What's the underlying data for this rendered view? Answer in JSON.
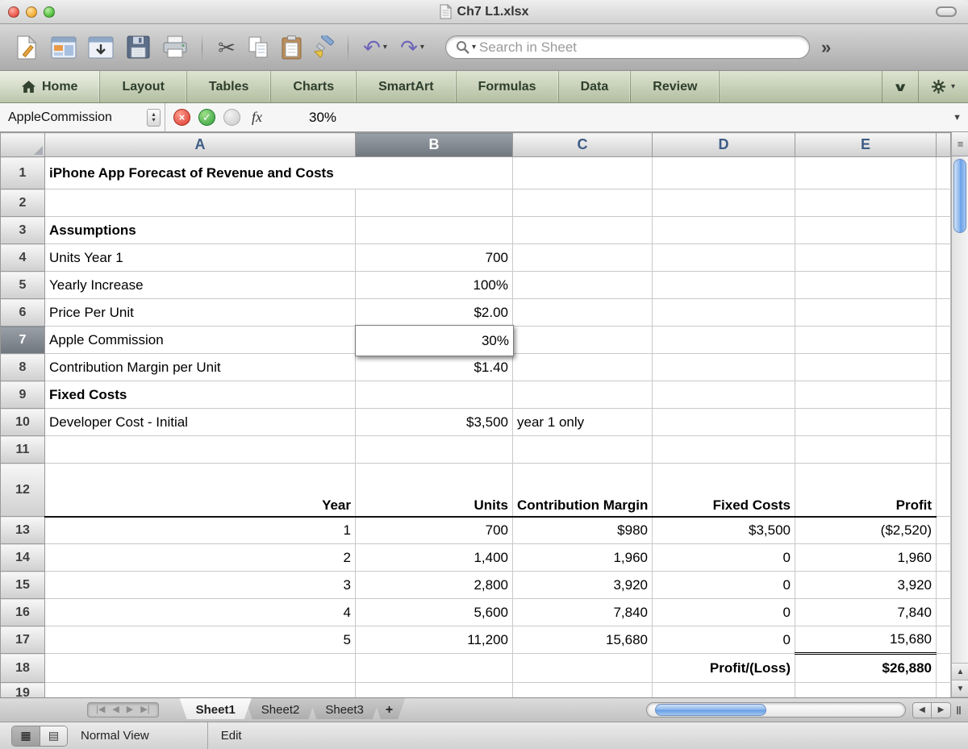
{
  "window": {
    "title": "Ch7 L1.xlsx"
  },
  "toolbar": {
    "search_placeholder": "Search in Sheet",
    "overflow": "»"
  },
  "ribbon": {
    "tabs": [
      "Home",
      "Layout",
      "Tables",
      "Charts",
      "SmartArt",
      "Formulas",
      "Data",
      "Review"
    ]
  },
  "formula_bar": {
    "name_box": "AppleCommission",
    "fx": "fx",
    "value": "30%"
  },
  "grid": {
    "columns": [
      "A",
      "B",
      "C",
      "D",
      "E"
    ],
    "rows": {
      "r1": {
        "n": "1",
        "a": "iPhone App Forecast of Revenue and Costs"
      },
      "r2": {
        "n": "2"
      },
      "r3": {
        "n": "3",
        "a": "Assumptions"
      },
      "r4": {
        "n": "4",
        "a": "Units Year 1",
        "b": "700"
      },
      "r5": {
        "n": "5",
        "a": "Yearly Increase",
        "b": "100%"
      },
      "r6": {
        "n": "6",
        "a": "Price Per Unit",
        "b": "$2.00"
      },
      "r7": {
        "n": "7",
        "a": "Apple Commission",
        "b": "30%"
      },
      "r8": {
        "n": "8",
        "a": "Contribution Margin per Unit",
        "b": "$1.40"
      },
      "r9": {
        "n": "9",
        "a": "Fixed  Costs"
      },
      "r10": {
        "n": "10",
        "a": "Developer Cost - Initial",
        "b": "$3,500",
        "c": "year 1 only"
      },
      "r11": {
        "n": "11"
      },
      "r12": {
        "n": "12",
        "a": "Year",
        "b": "Units",
        "c": "Contribution\nMargin",
        "d": "Fixed\nCosts",
        "e": "Profit"
      },
      "r13": {
        "n": "13",
        "a": "1",
        "b": "700",
        "c": "$980",
        "d": "$3,500",
        "e": "($2,520)"
      },
      "r14": {
        "n": "14",
        "a": "2",
        "b": "1,400",
        "c": "1,960",
        "d": "0",
        "e": "1,960"
      },
      "r15": {
        "n": "15",
        "a": "3",
        "b": "2,800",
        "c": "3,920",
        "d": "0",
        "e": "3,920"
      },
      "r16": {
        "n": "16",
        "a": "4",
        "b": "5,600",
        "c": "7,840",
        "d": "0",
        "e": "7,840"
      },
      "r17": {
        "n": "17",
        "a": "5",
        "b": "11,200",
        "c": "15,680",
        "d": "0",
        "e": "15,680"
      },
      "r18": {
        "n": "18",
        "d": "Profit/(Loss)",
        "e": "$26,880"
      },
      "r19": {
        "n": "19"
      }
    }
  },
  "sheet_bar": {
    "tabs": [
      "Sheet1",
      "Sheet2",
      "Sheet3"
    ],
    "add_label": "+"
  },
  "status_bar": {
    "view_label": "Normal View",
    "mode_label": "Edit"
  }
}
